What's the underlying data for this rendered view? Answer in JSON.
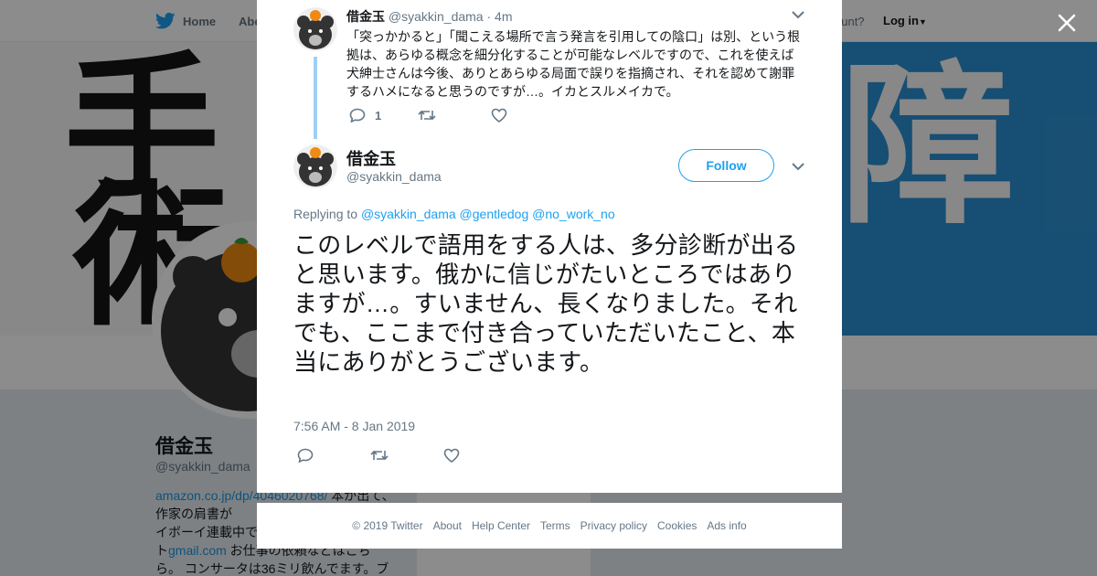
{
  "nav": {
    "home_label": "Home",
    "about_label": "Abo",
    "account_prompt": "ccount?",
    "login_label": "Log in"
  },
  "banner": {
    "glyph_left_top": "手",
    "glyph_left_bottom": "術",
    "glyph_right": "障"
  },
  "profile": {
    "name": "借金玉",
    "handle": "@syakkin_dama",
    "bio_link1": "amazon.co.jp/dp/4046020768/",
    "bio_text1": " 本が出て、作家の肩書が",
    "bio_text2": "イボーイ連載中で",
    "bio_text3": "ト",
    "bio_link2": "gmail.com",
    "bio_text4": " お仕事の依頼などはこちら。 コンサータは36ミリ飲んでます。ブ"
  },
  "ads_card": {
    "label": "Ads info"
  },
  "previous_tweet": {
    "name": "借金玉",
    "handle": "@syakkin_dama",
    "time": "· 4m",
    "text": "「突っかかると」「聞こえる場所で言う発言を引用しての陰口」は別、という根拠は、あらゆる概念を細分化することが可能なレベルですので、これを使えば犬紳士さんは今後、ありとあらゆる局面で誤りを指摘され、それを認めて謝罪するハメになると思うのですが…。イカとスルメイカで。",
    "reply_count": "1"
  },
  "main_tweet": {
    "name": "借金玉",
    "handle": "@syakkin_dama",
    "follow_label": "Follow",
    "replying_prefix": "Replying to ",
    "replying_to": [
      "@syakkin_dama",
      "@gentledog",
      "@no_work_no"
    ],
    "text": "このレベルで語用をする人は、多分診断が出ると思います。俄かに信じがたいところではありますが…。すいません、長くなりました。それでも、ここまで付き合っていただいたこと、本当にありがとうございます。",
    "timestamp": "7:56 AM - 8 Jan 2019"
  },
  "footer": {
    "copyright": "© 2019 Twitter",
    "links": [
      "About",
      "Help Center",
      "Terms",
      "Privacy policy",
      "Cookies",
      "Ads info"
    ]
  },
  "colors": {
    "twitter_blue": "#1da1f2",
    "link_blue": "#1b95e0",
    "thread_line": "#9fd0f2",
    "muted_text": "#657786"
  }
}
